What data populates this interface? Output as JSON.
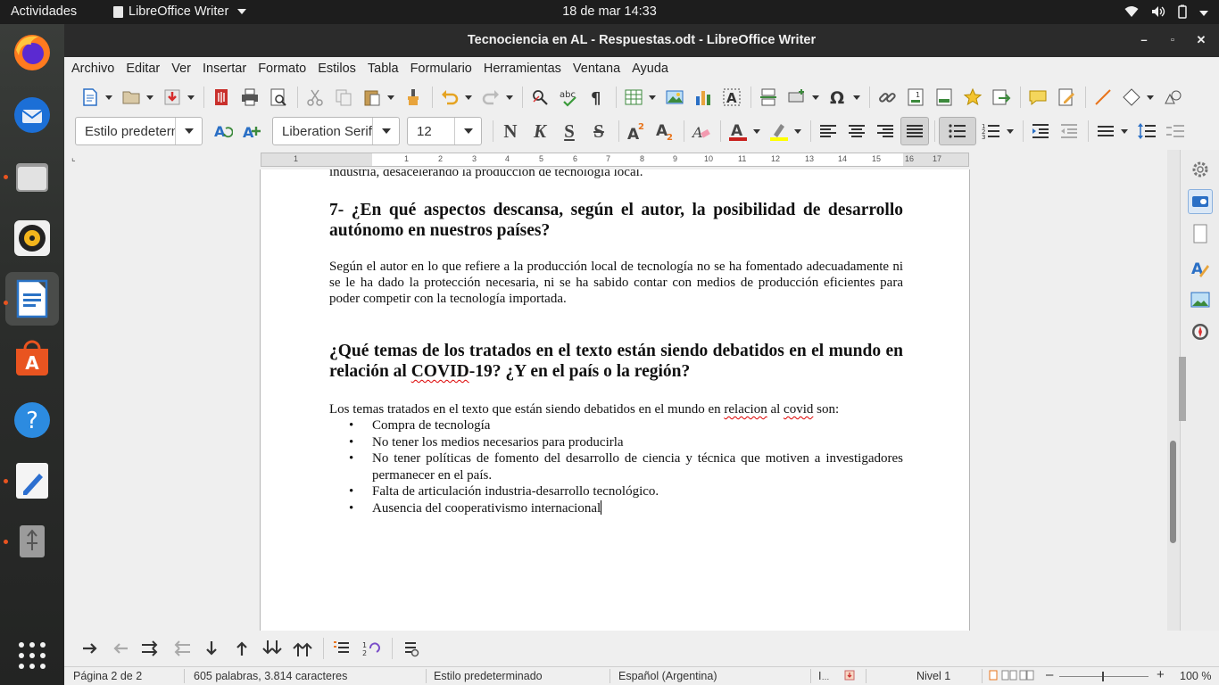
{
  "topbar": {
    "activities": "Actividades",
    "app_name": "LibreOffice Writer",
    "clock": "18 de mar  14:33"
  },
  "dock": {
    "items": [
      "firefox-icon",
      "thunderbird-icon",
      "files-icon",
      "rhythmbox-icon",
      "libreoffice-writer-icon",
      "ubuntu-software-icon",
      "help-icon",
      "text-editor-icon",
      "usb-drive-icon",
      "show-apps-icon"
    ]
  },
  "window": {
    "title": "Tecnociencia en AL - Respuestas.odt - LibreOffice Writer"
  },
  "menu": [
    "Archivo",
    "Editar",
    "Ver",
    "Insertar",
    "Formato",
    "Estilos",
    "Tabla",
    "Formulario",
    "Herramientas",
    "Ventana",
    "Ayuda"
  ],
  "format_bar": {
    "paragraph_style": "Estilo predeterminado",
    "font_name": "Liberation Serif",
    "font_size": "12",
    "bold": "N",
    "italic": "K",
    "underline": "S",
    "strike": "S",
    "font_color": "#c9211e",
    "highlight_color": "#ffff00"
  },
  "ruler": {
    "numbers": [
      "1",
      "1",
      "2",
      "3",
      "4",
      "5",
      "6",
      "7",
      "8",
      "9",
      "10",
      "11",
      "12",
      "13",
      "14",
      "15",
      "16",
      "17",
      "18"
    ]
  },
  "document": {
    "top_cut_line": "industria, desacelerando la producción de tecnología local.",
    "heading7": "7- ¿En qué aspectos descansa, según el autor, la posibilidad de desarrollo autónomo en nuestros países?",
    "answer7": "Según el autor en lo que refiere a la producción local de tecnología no se ha fomentado adecuadamente ni se le ha dado la protección necesaria, ni se ha sabido contar con medios de producción eficientes para poder competir con la tecnología importada.",
    "heading8_part1": "¿Qué temas de los tratados en el texto están siendo debatidos en el mundo en relación al ",
    "heading8_covid": "COVID",
    "heading8_part2": "-19? ¿Y en el país o la región?",
    "intro_part1": "Los temas tratados en el texto que están siendo debatidos en el mundo en ",
    "intro_relacion": "relacion",
    "intro_part2": " al ",
    "intro_covid": "covid",
    "intro_part3": " son:",
    "bullets": [
      "Compra de tecnología",
      "No tener los medios necesarios para producirla",
      "No tener políticas de fomento del desarrollo de ciencia y técnica que motiven a investigadores permanecer en el país.",
      "Falta de articulación industria-desarrollo tecnológico.",
      "Ausencia del cooperativismo internacional"
    ]
  },
  "statusbar": {
    "page": "Página 2 de 2",
    "words": "605 palabras, 3.814 caracteres",
    "style": "Estilo predeterminado",
    "language": "Español (Argentina)",
    "level": "Nivel 1",
    "zoom": "100 %"
  }
}
